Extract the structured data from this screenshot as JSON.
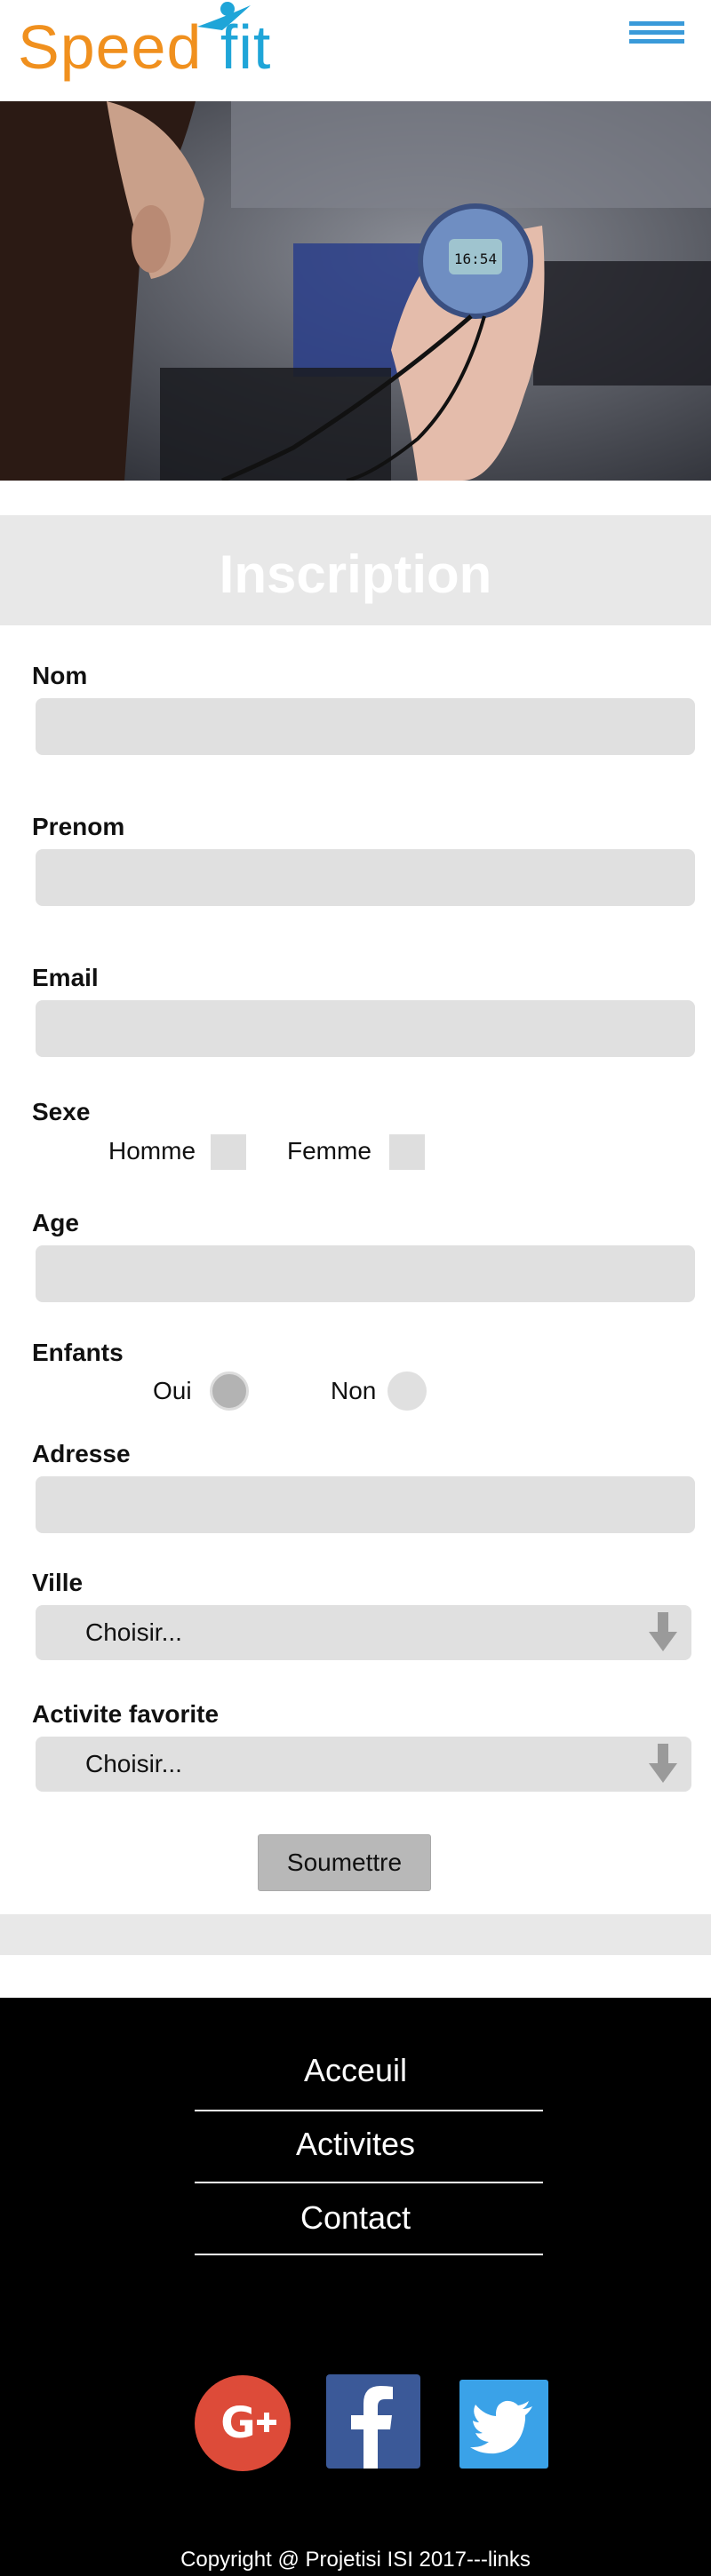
{
  "header": {
    "logo_part1": "Speed",
    "logo_part2": "fit",
    "menu_icon": "hamburger-menu-icon"
  },
  "hero": {
    "description_icon": "stopwatch-photo"
  },
  "form": {
    "title": "Inscription",
    "nom_label": "Nom",
    "prenom_label": "Prenom",
    "email_label": "Email",
    "sexe_label": "Sexe",
    "sexe_options": [
      "Homme",
      "Femme"
    ],
    "age_label": "Age",
    "enfants_label": "Enfants",
    "enfants_options": [
      "Oui",
      "Non"
    ],
    "enfants_selected": "Oui",
    "adresse_label": "Adresse",
    "ville_label": "Ville",
    "ville_value": "Choisir...",
    "activite_label": "Activite favorite",
    "activite_value": "Choisir...",
    "submit_label": "Soumettre"
  },
  "footer": {
    "nav": [
      "Acceuil",
      "Activites",
      "Contact"
    ],
    "social": [
      "google-plus-icon",
      "facebook-icon",
      "twitter-icon"
    ],
    "copyright": "Copyright @ Projetisi ISI 2017---links"
  },
  "colors": {
    "logo_orange": "#f0901e",
    "logo_blue": "#1fa5d8",
    "band": "#e8e8e8",
    "field": "#e0e0e0",
    "footer": "#000000"
  }
}
